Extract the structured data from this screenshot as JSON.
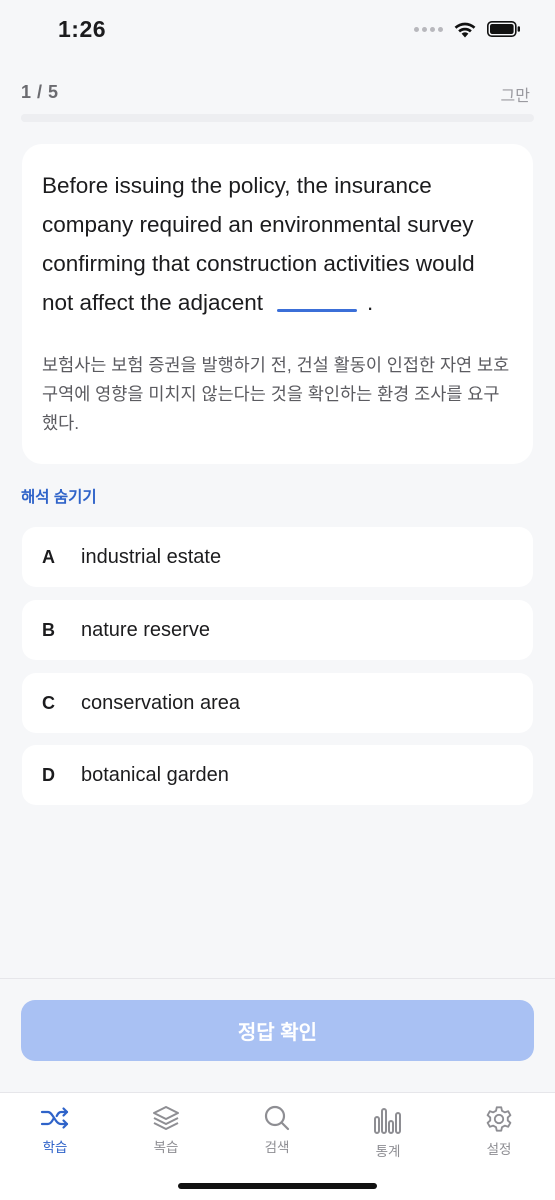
{
  "status_bar": {
    "time": "1:26"
  },
  "header": {
    "progress": "1 / 5",
    "progress_fraction": 0.2,
    "stop_label": "그만"
  },
  "question": {
    "lines": [
      "Before issuing the policy, the insurance",
      "company required an environmental survey",
      "confirming that construction activities would",
      "not affect the adjacent"
    ],
    "after_blank": ".",
    "translation": "보험사는 보험 증권을 발행하기 전, 건설 활동이 인접한 자연 보호구역에 영향을 미치지 않는다는 것을 확인하는 환경 조사를 요구했다."
  },
  "toggle_translation_label": "해석 숨기기",
  "options": [
    {
      "letter": "A",
      "text": "industrial estate"
    },
    {
      "letter": "B",
      "text": "nature reserve"
    },
    {
      "letter": "C",
      "text": "conservation area"
    },
    {
      "letter": "D",
      "text": "botanical garden"
    }
  ],
  "confirm_label": "정답 확인",
  "tabs": [
    {
      "label": "학습",
      "icon": "shuffle-icon",
      "active": true
    },
    {
      "label": "복습",
      "icon": "layers-icon",
      "active": false
    },
    {
      "label": "검색",
      "icon": "search-icon",
      "active": false
    },
    {
      "label": "통계",
      "icon": "bar-chart-icon",
      "active": false
    },
    {
      "label": "설정",
      "icon": "gear-icon",
      "active": false
    }
  ],
  "colors": {
    "accent": "#2f63c9",
    "confirm_disabled": "#a9c1f3",
    "blank_line": "#3b6fd8"
  }
}
